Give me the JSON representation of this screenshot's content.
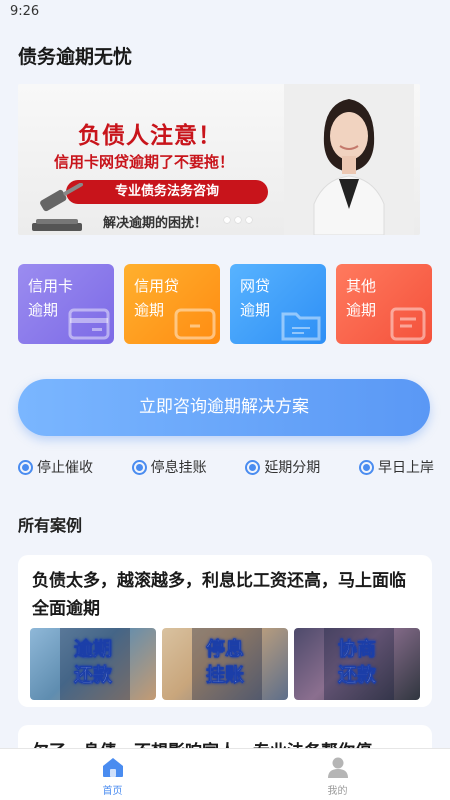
{
  "status": {
    "time": "9:26"
  },
  "app": {
    "title": "债务逾期无忧"
  },
  "banner": {
    "heading": "负债人注意！",
    "subheading": "信用卡网贷逾期了不要拖！",
    "pill": "专业债务法务咨询",
    "tagline": "解决逾期的困扰！"
  },
  "categories": [
    {
      "line1": "信用卡",
      "line2": "逾期"
    },
    {
      "line1": "信用贷",
      "line2": "逾期"
    },
    {
      "line1": "网贷",
      "line2": "逾期"
    },
    {
      "line1": "其他",
      "line2": "逾期"
    }
  ],
  "cta": {
    "label": "立即咨询逾期解决方案"
  },
  "features": [
    "停止催收",
    "停息挂账",
    "延期分期",
    "早日上岸"
  ],
  "section": {
    "title": "所有案例"
  },
  "cases": [
    {
      "title": "负债太多，越滚越多，利息比工资还高，马上面临全面逾期",
      "images": [
        {
          "line1": "逾期",
          "line2": "还款"
        },
        {
          "line1": "停息",
          "line2": "挂账"
        },
        {
          "line1": "协商",
          "line2": "还款"
        }
      ]
    },
    {
      "title": "欠了一身债，不想影响家人，专业法务帮你停"
    }
  ],
  "tabbar": {
    "items": [
      {
        "label": "首页",
        "icon": "home-icon",
        "active": true
      },
      {
        "label": "我的",
        "icon": "user-icon",
        "active": false
      }
    ]
  },
  "colors": {
    "primary": "#4a8cf0",
    "banner_red": "#c8141b"
  }
}
